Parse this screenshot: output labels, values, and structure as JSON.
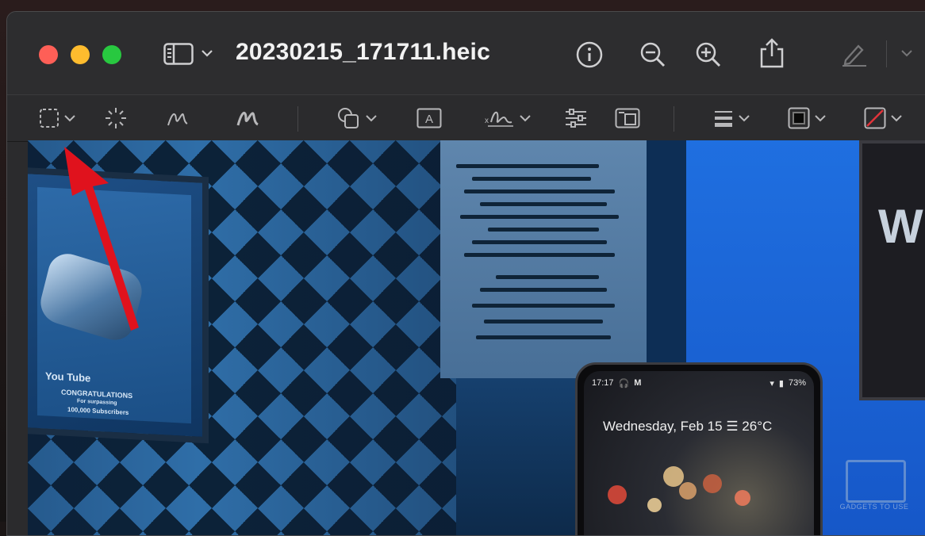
{
  "window": {
    "title": "20230215_171711.heic"
  },
  "toolbar": {
    "icons": [
      "sidebar-icon",
      "chevron-down-icon",
      "info-icon",
      "zoom-out-icon",
      "zoom-in-icon",
      "share-icon",
      "markup-pencil-icon"
    ]
  },
  "markup_toolbar": {
    "tools": [
      "rectangular-selection-icon",
      "instant-alpha-icon",
      "sketch-icon",
      "draw-icon",
      "shapes-icon",
      "text-icon",
      "sign-icon",
      "adjust-color-icon",
      "adjust-size-icon",
      "shape-style-icon",
      "border-color-icon",
      "fill-color-icon"
    ],
    "text_tool_label": "A"
  },
  "photo": {
    "phone_time": "17:17",
    "phone_battery": "73%",
    "phone_date": "Wednesday, Feb 15",
    "phone_temp": "26°C",
    "plaque_brand": "You Tube",
    "plaque_congrats": "CONGRATULATIONS",
    "plaque_for": "For surpassing",
    "plaque_subs": "100,000 Subscribers",
    "poster_text": "W"
  },
  "watermark": {
    "text": "GADGETS TO USE"
  },
  "colors": {
    "close": "#fe5f57",
    "minimize": "#febc2e",
    "maximize": "#28c840",
    "annotation_arrow": "#e0121d"
  }
}
